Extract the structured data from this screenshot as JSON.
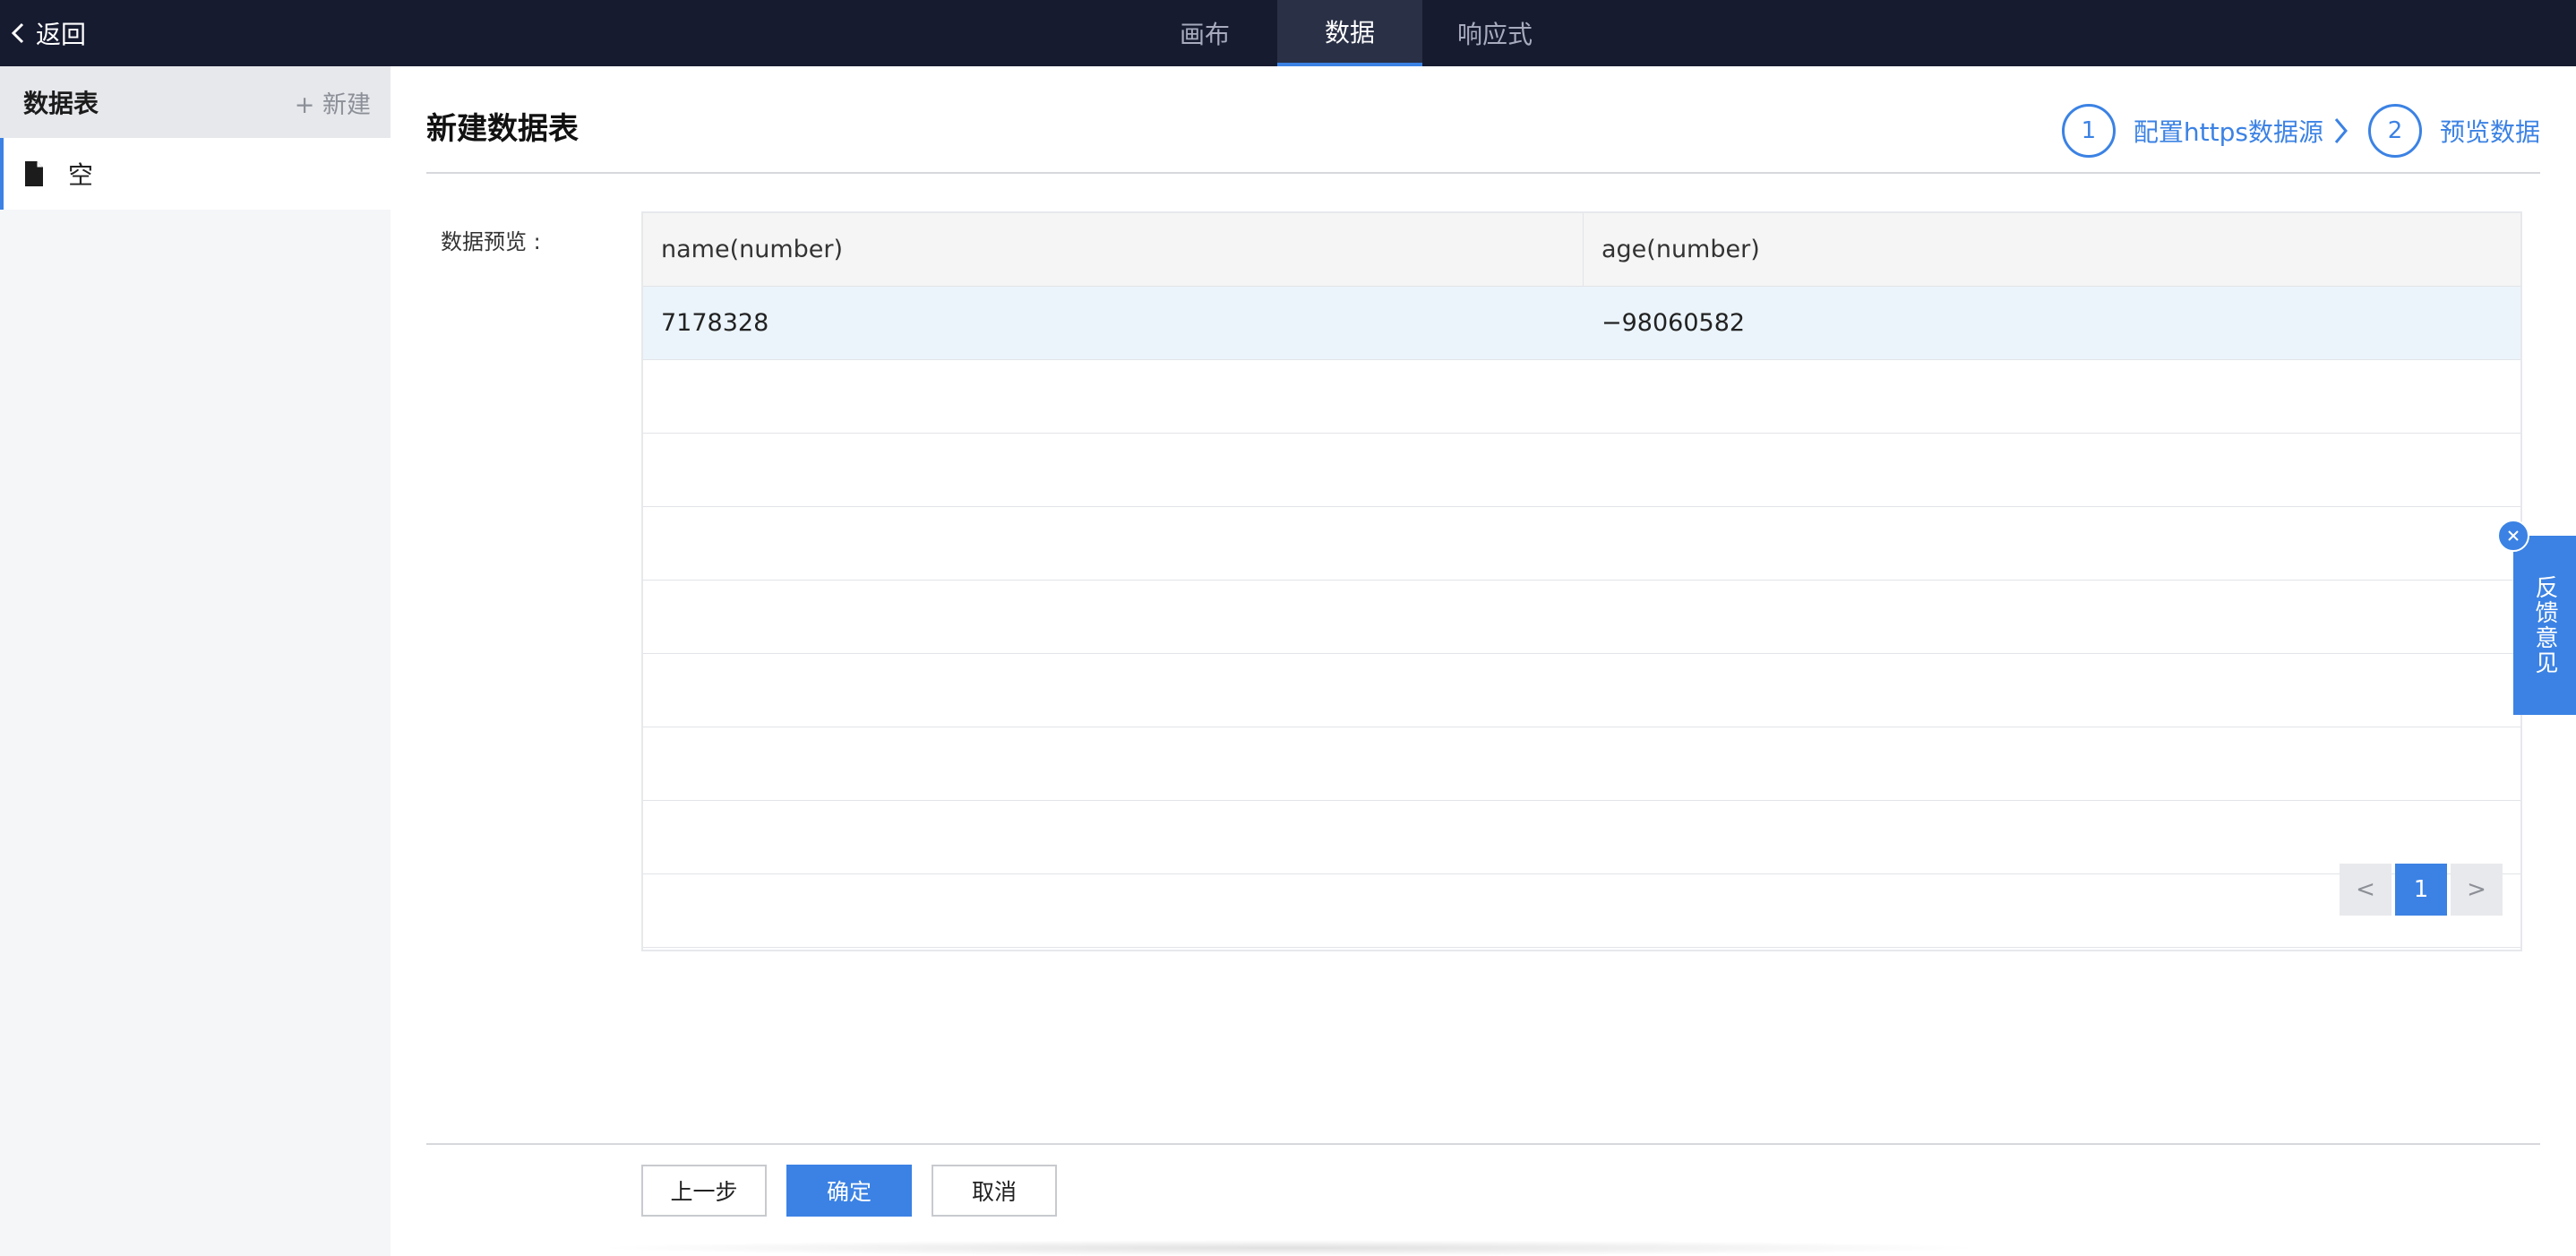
{
  "topbar": {
    "back_label": "返回",
    "tabs": [
      {
        "label": "画布",
        "active": false
      },
      {
        "label": "数据",
        "active": true
      },
      {
        "label": "响应式",
        "active": false
      }
    ]
  },
  "sidebar": {
    "title": "数据表",
    "new_label": "+ 新建",
    "items": [
      {
        "label": "空",
        "icon": "file-icon",
        "selected": true
      }
    ]
  },
  "main": {
    "title": "新建数据表",
    "steps": [
      {
        "number": "1",
        "label": "配置https数据源"
      },
      {
        "number": "2",
        "label": "预览数据"
      }
    ],
    "preview_label": "数据预览 :",
    "table": {
      "columns": [
        "name(number)",
        "age(number)"
      ],
      "rows": [
        [
          "7178328",
          "−98060582"
        ]
      ],
      "empty_rows": 8
    },
    "pagination": {
      "prev": "<",
      "current": "1",
      "next": ">"
    },
    "buttons": {
      "prev_step": "上一步",
      "confirm": "确定",
      "cancel": "取消"
    }
  },
  "feedback": {
    "label": "反馈意见"
  },
  "colors": {
    "topbar_bg": "#171b30",
    "accent": "#3b82e4",
    "sidebar_bg": "#f5f6f8",
    "selected_row_bg": "#ebf4fb"
  }
}
